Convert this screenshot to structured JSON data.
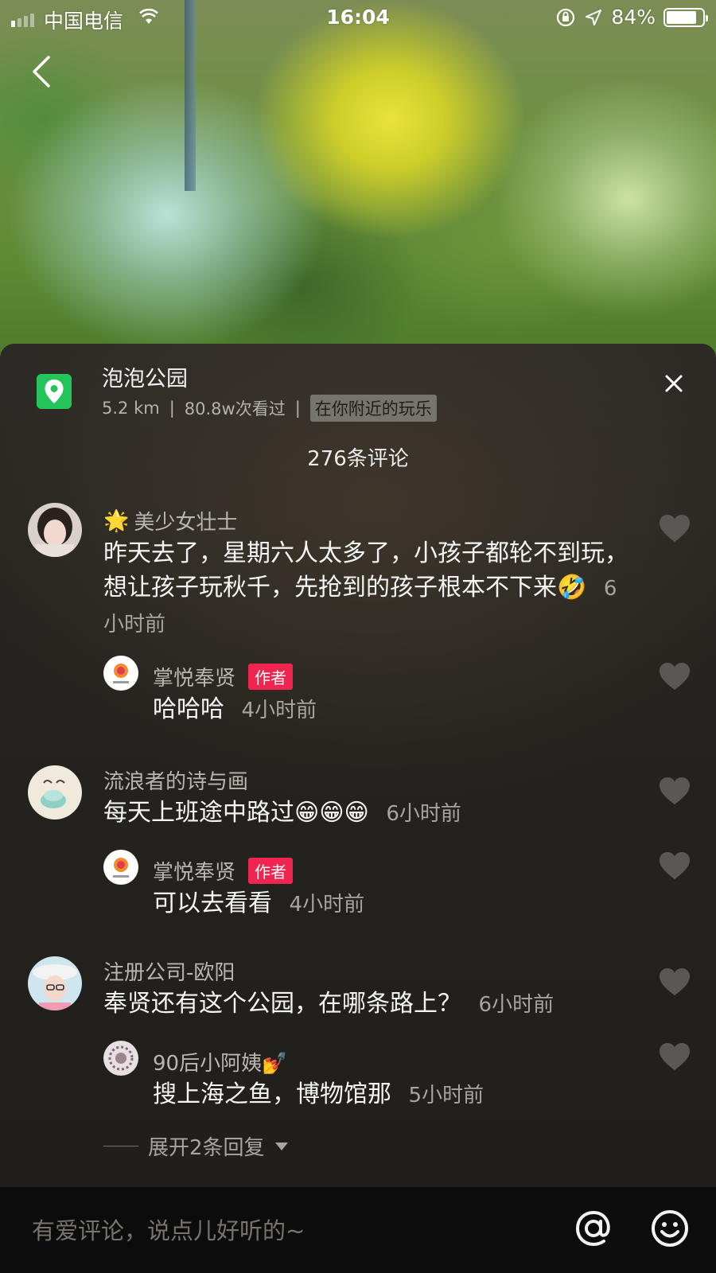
{
  "status_bar": {
    "carrier": "中国电信",
    "time": "16:04",
    "battery": "84%",
    "battery_level": 0.84
  },
  "place": {
    "name": "泡泡公园",
    "distance": "5.2 km",
    "separator": "|",
    "views": "80.8w次看过",
    "tag": "在你附近的玩乐"
  },
  "comments_header": {
    "count_label": "276条评论"
  },
  "comments": [
    {
      "user": "美少女壮士",
      "user_prefix_emoji": "🌟",
      "text": "昨天去了，星期六人太多了，小孩子都轮不到玩，想让孩子玩秋千，先抢到的孩子根本不下来🤣",
      "time": "6小时前",
      "replies": [
        {
          "user": "掌悦奉贤",
          "badge": "作者",
          "text": "哈哈哈",
          "time": "4小时前"
        }
      ]
    },
    {
      "user": "流浪者的诗与画",
      "text": "每天上班途中路过😁😁😁",
      "time": "6小时前",
      "replies": [
        {
          "user": "掌悦奉贤",
          "badge": "作者",
          "text": "可以去看看",
          "time": "4小时前"
        }
      ]
    },
    {
      "user": "注册公司-欧阳",
      "text": "奉贤还有这个公园，在哪条路上？",
      "time": "6小时前",
      "replies": [
        {
          "user": "90后小阿姨💅",
          "text": "搜上海之鱼，博物馆那",
          "time": "5小时前"
        }
      ]
    }
  ],
  "expand_replies": "展开2条回复",
  "input": {
    "placeholder": "有爱评论，说点儿好听的~",
    "at_symbol": "@"
  },
  "colors": {
    "place_icon": "#25c45a",
    "author_badge": "#f0254f",
    "sheet_bg": "#25231f",
    "input_bar_bg": "#0c0c0c"
  },
  "icons": [
    "back-arrow-icon",
    "location-pin-icon",
    "close-icon",
    "heart-icon",
    "at-icon",
    "emoji-icon",
    "expand-arrow-icon"
  ]
}
